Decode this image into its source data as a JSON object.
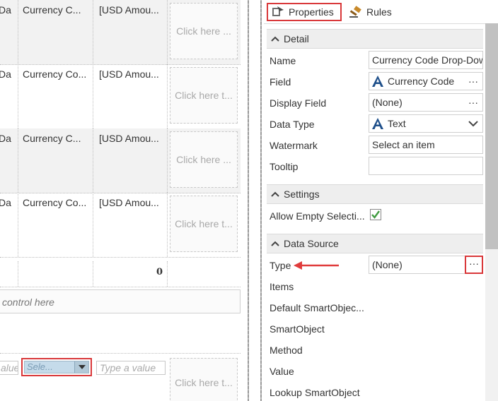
{
  "canvas": {
    "rows": [
      {
        "col1": "Da",
        "col2": "Currency C...",
        "col3": "[USD Amou...",
        "click": "Click here ..."
      },
      {
        "col1": "Da",
        "col2": "Currency Co...",
        "col3": "[USD Amou...",
        "click": "Click here t..."
      },
      {
        "col1": "Da",
        "col2": "Currency C...",
        "col3": "[USD Amou...",
        "click": "Click here ..."
      },
      {
        "col1": "Da",
        "col2": "Currency Co...",
        "col3": "[USD Amou...",
        "click": "Click here t..."
      }
    ],
    "total": "0",
    "drop_zone": "control here",
    "bottom": {
      "input1": "alue",
      "dropdown": "Sele...",
      "input2": "Type a value",
      "click": "Click here t..."
    }
  },
  "tabs": {
    "properties": "Properties",
    "rules": "Rules"
  },
  "detail": {
    "header": "Detail",
    "name_label": "Name",
    "name_value": "Currency Code Drop-Dow",
    "field_label": "Field",
    "field_value": "Currency Code",
    "display_field_label": "Display Field",
    "display_field_value": "(None)",
    "data_type_label": "Data Type",
    "data_type_value": "Text",
    "watermark_label": "Watermark",
    "watermark_value": "Select an item",
    "tooltip_label": "Tooltip",
    "tooltip_value": ""
  },
  "settings": {
    "header": "Settings",
    "allow_empty_label": "Allow Empty Selecti...",
    "allow_empty_checked": true
  },
  "data_source": {
    "header": "Data Source",
    "type_label": "Type",
    "type_value": "(None)",
    "items_label": "Items",
    "default_smartobject_label": "Default SmartObjec...",
    "smartobject_label": "SmartObject",
    "method_label": "Method",
    "value_label": "Value",
    "lookup_smartobject_label": "Lookup SmartObject"
  },
  "ellipsis": "···",
  "colors": {
    "highlight_red": "#d9383a",
    "arrow_red": "#e03c3c",
    "check_green": "#3f9b3f",
    "icon_blue": "#1e4f8a"
  }
}
